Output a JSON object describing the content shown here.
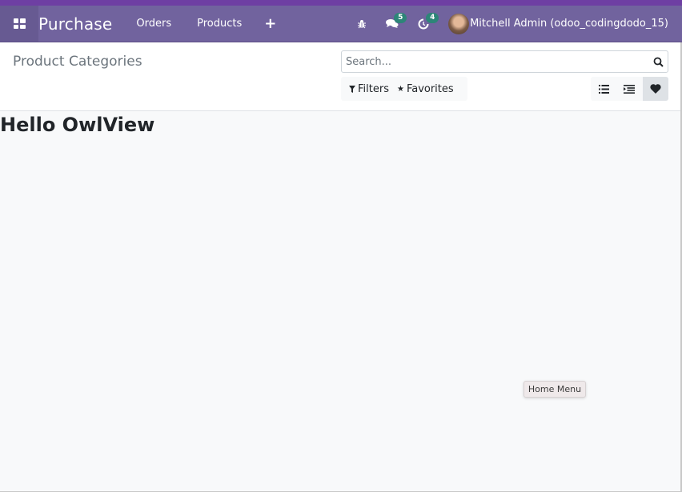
{
  "navbar": {
    "apps_icon": "apps-grid-icon",
    "brand": "Purchase",
    "menus": [
      {
        "label": "Orders"
      },
      {
        "label": "Products"
      }
    ],
    "plus_icon": "+",
    "systray": {
      "debug_icon": "bug-icon",
      "messages_icon": "chat-icon",
      "messages_count": "5",
      "activities_icon": "clock-icon",
      "activities_count": "4"
    },
    "user_name": "Mitchell Admin (odoo_codingdodo_15)"
  },
  "control_panel": {
    "breadcrumb": "Product Categories",
    "search": {
      "placeholder": "Search...",
      "value": ""
    },
    "filters_label": "Filters",
    "favorites_label": "Favorites",
    "view_switcher": [
      {
        "view": "list",
        "icon": "list-icon",
        "active": false
      },
      {
        "view": "hierarchy",
        "icon": "indent-list-icon",
        "active": false
      },
      {
        "view": "owl",
        "icon": "heart-icon",
        "active": true
      }
    ]
  },
  "content": {
    "heading": "Hello OwlView"
  },
  "tooltip": {
    "text": "Home Menu"
  },
  "colors": {
    "navbar": "#71639e",
    "top_strip": "#6e3fa3",
    "badge": "#2d8578"
  }
}
